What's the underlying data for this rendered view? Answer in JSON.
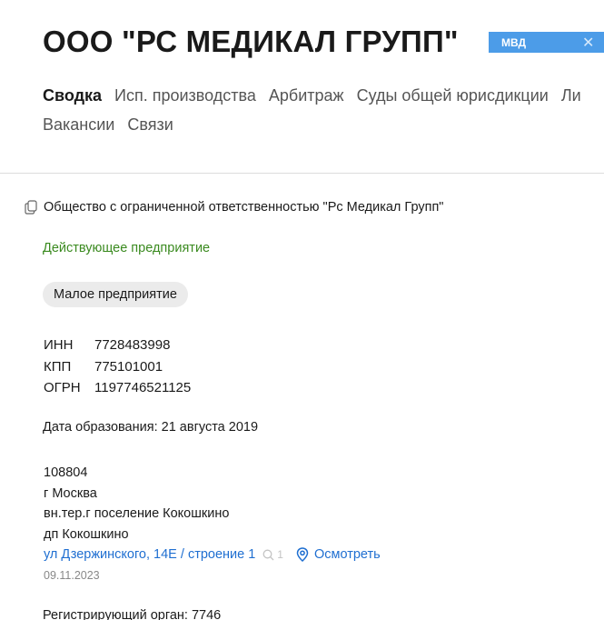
{
  "company": {
    "title": "ООО \"РС МЕДИКАЛ ГРУПП\"",
    "badge_label": "МВД",
    "badge_close": "✕"
  },
  "tabs": {
    "row1": [
      "Сводка",
      "Исп. производства",
      "Арбитраж",
      "Суды общей юрисдикции",
      "Ли"
    ],
    "row2": [
      "Вакансии",
      "Связи"
    ],
    "active": "Сводка"
  },
  "summary": {
    "full_name": "Общество с ограниченной ответственностью \"Рс Медикал Групп\"",
    "status": "Действующее предприятие",
    "size": "Малое предприятие",
    "ids": [
      {
        "key": "ИНН",
        "value": "7728483998"
      },
      {
        "key": "КПП",
        "value": "775101001"
      },
      {
        "key": "ОГРН",
        "value": "1197746521125"
      }
    ],
    "founded": "Дата образования: 21 августа 2019",
    "address": {
      "postcode": "108804",
      "city": "г Москва",
      "district": "вн.тер.г поселение Кокошкино",
      "settlement": "дп Кокошкино",
      "street": "ул Дзержинского, 14Е / строение 1",
      "search_count": "1",
      "view_label": "Осмотреть",
      "date": "09.11.2023"
    },
    "registrar": "Регистрирующий орган: 7746"
  },
  "colors": {
    "status_green": "#3a8a1f",
    "link_blue": "#1f6fd1",
    "badge_blue": "#4c9ce8",
    "chip_gray": "#ebebeb"
  }
}
